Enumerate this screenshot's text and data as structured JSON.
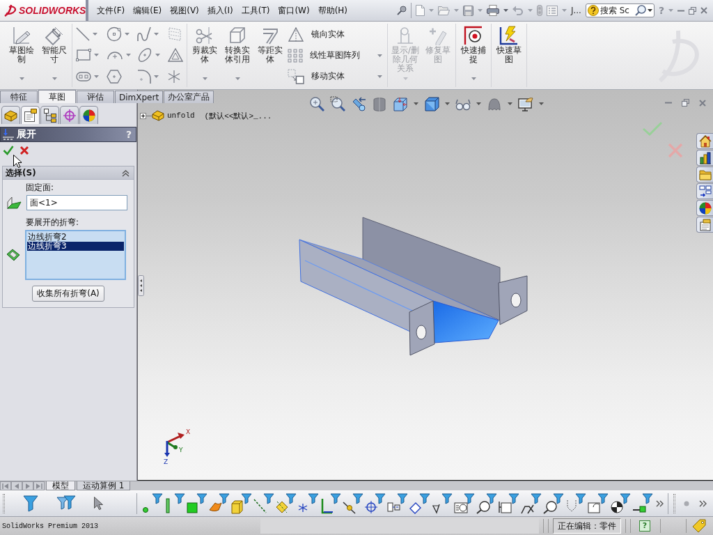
{
  "title_bar": {
    "logo": "SOLIDWORKS",
    "menu": [
      "文件(F)",
      "编辑(E)",
      "视图(V)",
      "插入(I)",
      "工具(T)",
      "窗口(W)",
      "帮助(H)"
    ],
    "toolbar_label": "J...",
    "search": {
      "placeholder": "搜索 Sc"
    },
    "help": "?"
  },
  "ribbon": {
    "groups": [
      {
        "items": [
          {
            "kind": "large",
            "label": "草图绘制",
            "dropdown": true,
            "disabled": false
          },
          {
            "kind": "large",
            "label": "智能尺寸",
            "dropdown": true,
            "disabled": false
          }
        ]
      },
      {
        "items": [
          {
            "kind": "tools"
          }
        ]
      },
      {
        "items": [
          {
            "kind": "large",
            "label": "剪裁实体",
            "dropdown": true,
            "disabled": false
          },
          {
            "kind": "large",
            "label": "转换实体引用",
            "dropdown": true,
            "disabled": false
          },
          {
            "kind": "large",
            "label": "等距实体",
            "dropdown": false,
            "disabled": false
          },
          {
            "kind": "stack",
            "entries": [
              {
                "label": "镜向实体",
                "dropdown": false
              },
              {
                "label": "线性草图阵列",
                "dropdown": true
              },
              {
                "label": "移动实体",
                "dropdown": true
              }
            ]
          }
        ]
      },
      {
        "items": [
          {
            "kind": "large",
            "label": "显示/删除几何关系",
            "dropdown": true,
            "disabled": true
          },
          {
            "kind": "large",
            "label": "修复草图",
            "dropdown": false,
            "disabled": true
          }
        ]
      },
      {
        "items": [
          {
            "kind": "large",
            "label": "快速捕捉",
            "dropdown": true,
            "disabled": false
          }
        ]
      },
      {
        "items": [
          {
            "kind": "large",
            "label": "快速草图",
            "dropdown": false,
            "disabled": false
          }
        ]
      }
    ]
  },
  "command_tabs": [
    {
      "label": "特征",
      "selected": false
    },
    {
      "label": "草图",
      "selected": true
    },
    {
      "label": "评估",
      "selected": false
    },
    {
      "label": "DimXpert",
      "selected": false
    },
    {
      "label": "办公室产品",
      "selected": false
    }
  ],
  "manager_tabs": [
    {
      "selected": false
    },
    {
      "selected": true
    },
    {
      "selected": false
    },
    {
      "selected": false
    },
    {
      "selected": false
    }
  ],
  "property_manager": {
    "title": "展开",
    "help": "?",
    "section": {
      "title": "选择(S)",
      "expanded": true,
      "fixed_face": {
        "label": "固定面:",
        "value": "面<1>"
      },
      "bends": {
        "label": "要展开的折弯:",
        "items": [
          {
            "text": "边线折弯2",
            "selected": false
          },
          {
            "text": "边线折弯3",
            "selected": true
          }
        ]
      },
      "collect_button": "收集所有折弯(A)"
    }
  },
  "graphics": {
    "tree_flyout": {
      "expanded": false,
      "part": "unfold",
      "configuration": "(默认<<默认>_..."
    },
    "triad": [
      "X",
      "Y",
      "Z"
    ]
  },
  "bottom_tabs": [
    {
      "label": "模型",
      "selected": true
    },
    {
      "label": "运动算例 1",
      "selected": false
    }
  ],
  "status_bar": {
    "product": "SolidWorks Premium 2013",
    "mode": "正在编辑：零件",
    "help": "?"
  }
}
